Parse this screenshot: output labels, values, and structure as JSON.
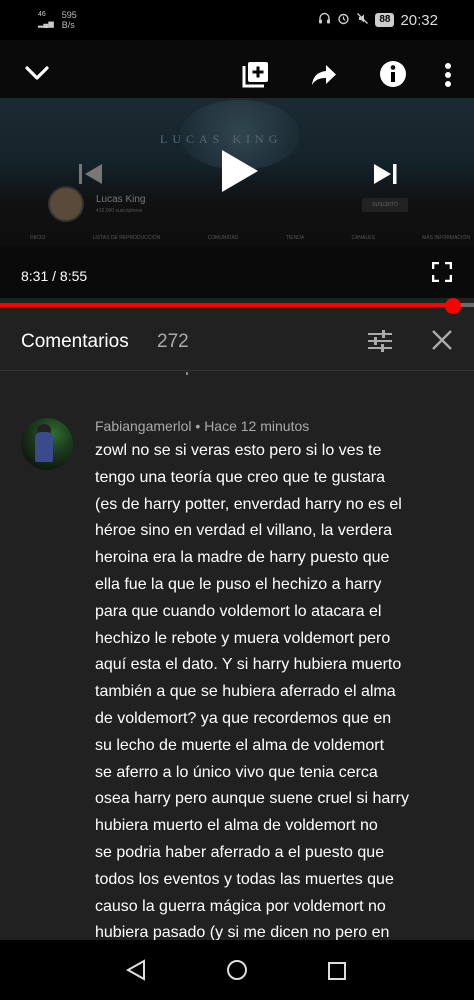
{
  "status_bar": {
    "signal": "46",
    "speed_value": "595",
    "speed_unit": "B/s",
    "battery": "88",
    "time": "20:32"
  },
  "player": {
    "banner_text": "LUCAS KING",
    "channel_name": "Lucas King",
    "channel_subs": "410.000 suscriptores",
    "subscribe_label": "SUSCRITO",
    "channel_tabs": [
      "INICIO",
      "LISTAS DE REPRODUCCIÓN",
      "COMUNIDAD",
      "TIENDA",
      "CANALES",
      "MÁS INFORMACIÓN"
    ],
    "time_current": "8:31",
    "time_separator": " / ",
    "time_total": "8:55",
    "progress_fraction": 0.955
  },
  "comments": {
    "title": "Comentarios",
    "count": "272",
    "item": {
      "author": "Fabiangamerlol",
      "separator": " • ",
      "time": "Hace 12 minutos",
      "text": "zowl no se si veras esto pero si lo ves te\ntengo una teoría que creo  que te gustara\n(es de harry potter, enverdad harry no es el\nhéroe sino en verdad el villano, la verdera\nheroina era la madre de harry puesto que\nella fue la que le puso el hechizo a harry\npara que cuando voldemort lo atacara el\nhechizo le rebote y muera voldemort pero\naquí esta el dato. Y si harry hubiera muerto\ntambién a que se hubiera aferrado el alma\nde voldemort? ya que recordemos que en\nsu lecho de muerte el alma de voldemort\nse aferro a lo único vivo que tenia cerca\nosea harry pero aunque suene cruel si harry\nhubiera muerto el alma de voldemort no\nse podria haber aferrado a el puesto que\ntodos los eventos y todas las muertes que\ncauso la guerra mágica por voldemort no\nhubiera pasado (y si me dicen no pero en"
    }
  },
  "colors": {
    "accent": "#ff0000",
    "panel_bg": "#212121",
    "meta_text": "#aaaaaa"
  },
  "icons": [
    "chevron-down-icon",
    "add-to-playlist-icon",
    "share-icon",
    "info-icon",
    "more-vert-icon",
    "previous-icon",
    "play-icon",
    "next-icon",
    "fullscreen-icon",
    "filter-icon",
    "close-icon",
    "back-icon",
    "home-icon",
    "recents-icon"
  ]
}
